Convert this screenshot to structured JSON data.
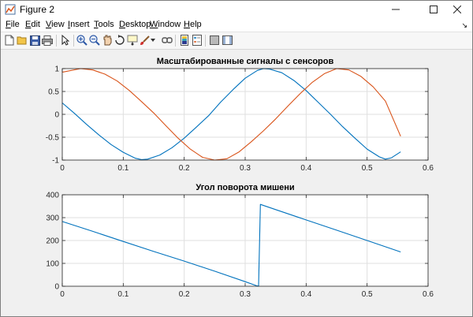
{
  "window": {
    "title": "Figure 2"
  },
  "menu": {
    "items": [
      {
        "id": "file",
        "mnemonic": "F",
        "rest": "ile"
      },
      {
        "id": "edit",
        "mnemonic": "E",
        "rest": "dit"
      },
      {
        "id": "view",
        "mnemonic": "V",
        "rest": "iew"
      },
      {
        "id": "insert",
        "mnemonic": "I",
        "rest": "nsert"
      },
      {
        "id": "tools",
        "mnemonic": "T",
        "rest": "ools"
      },
      {
        "id": "desktop",
        "mnemonic": "D",
        "rest": "esktop"
      },
      {
        "id": "window",
        "mnemonic": "W",
        "rest": "indow"
      },
      {
        "id": "help",
        "mnemonic": "H",
        "rest": "elp"
      }
    ]
  },
  "toolbar": {
    "icons": [
      "new-figure-icon",
      "open-file-icon",
      "save-icon",
      "print-icon",
      "select-arrow-icon",
      "zoom-in-icon",
      "zoom-out-icon",
      "pan-icon",
      "rotate-icon",
      "data-cursor-icon",
      "brush-icon",
      "brush-dropdown-icon",
      "link-plot-icon",
      "insert-colorbar-icon",
      "insert-legend-icon",
      "hide-plot-tools-icon",
      "show-plot-tools-icon"
    ]
  },
  "colors": {
    "series1": "#0072BD",
    "series2": "#D95319",
    "grid": "#dfdfdf",
    "axes_bg": "#ffffff"
  },
  "chart_data": [
    {
      "type": "line",
      "title": "Масштабированные сигналы с сенсоров",
      "xlabel": "",
      "ylabel": "",
      "xlim": [
        0,
        0.6
      ],
      "ylim": [
        -1,
        1
      ],
      "xticks": [
        0,
        0.1,
        0.2,
        0.3,
        0.4,
        0.5,
        0.6
      ],
      "yticks": [
        -1,
        -0.5,
        0,
        0.5,
        1
      ],
      "xtick_labels": [
        "0",
        "0.1",
        "0.2",
        "0.3",
        "0.4",
        "0.5",
        "0.6"
      ],
      "ytick_labels": [
        "-1",
        "-0.5",
        "0",
        "0.5",
        "1"
      ],
      "grid": true,
      "series": [
        {
          "color": "#0072BD",
          "x": [
            0,
            0.02,
            0.04,
            0.06,
            0.08,
            0.1,
            0.12,
            0.13,
            0.14,
            0.16,
            0.18,
            0.2,
            0.22,
            0.24,
            0.26,
            0.28,
            0.3,
            0.32,
            0.33,
            0.34,
            0.36,
            0.38,
            0.4,
            0.42,
            0.44,
            0.46,
            0.48,
            0.5,
            0.52,
            0.53,
            0.54,
            0.555
          ],
          "y": [
            0.25,
            0.02,
            -0.22,
            -0.45,
            -0.66,
            -0.83,
            -0.96,
            -0.99,
            -0.98,
            -0.89,
            -0.73,
            -0.52,
            -0.28,
            -0.03,
            0.27,
            0.54,
            0.79,
            0.96,
            1.0,
            0.99,
            0.91,
            0.74,
            0.52,
            0.26,
            0.0,
            -0.27,
            -0.52,
            -0.76,
            -0.93,
            -0.98,
            -0.95,
            -0.82
          ]
        },
        {
          "color": "#D95319",
          "x": [
            0,
            0.03,
            0.05,
            0.07,
            0.09,
            0.11,
            0.13,
            0.15,
            0.17,
            0.19,
            0.21,
            0.23,
            0.25,
            0.27,
            0.29,
            0.31,
            0.33,
            0.35,
            0.37,
            0.39,
            0.41,
            0.43,
            0.45,
            0.47,
            0.49,
            0.51,
            0.53,
            0.555
          ],
          "y": [
            0.92,
            1.0,
            0.97,
            0.88,
            0.73,
            0.52,
            0.28,
            0.03,
            -0.25,
            -0.52,
            -0.76,
            -0.94,
            -1.0,
            -0.97,
            -0.82,
            -0.6,
            -0.36,
            -0.1,
            0.18,
            0.45,
            0.7,
            0.89,
            1.0,
            0.97,
            0.83,
            0.6,
            0.29,
            -0.48
          ]
        }
      ]
    },
    {
      "type": "line",
      "title": "Угол поворота мишени",
      "xlabel": "",
      "ylabel": "",
      "xlim": [
        0,
        0.6
      ],
      "ylim": [
        0,
        400
      ],
      "xticks": [
        0,
        0.1,
        0.2,
        0.3,
        0.4,
        0.5,
        0.6
      ],
      "yticks": [
        0,
        100,
        200,
        300,
        400
      ],
      "xtick_labels": [
        "0",
        "0.1",
        "0.2",
        "0.3",
        "0.4",
        "0.5",
        "0.6"
      ],
      "ytick_labels": [
        "0",
        "100",
        "200",
        "300",
        "400"
      ],
      "grid": true,
      "series": [
        {
          "color": "#0072BD",
          "x": [
            0,
            0.05,
            0.1,
            0.15,
            0.2,
            0.25,
            0.3,
            0.318,
            0.322,
            0.325,
            0.35,
            0.4,
            0.45,
            0.5,
            0.555
          ],
          "y": [
            283,
            240,
            196,
            152,
            110,
            66,
            20,
            3,
            0,
            358,
            335,
            290,
            245,
            200,
            150
          ]
        }
      ]
    }
  ]
}
